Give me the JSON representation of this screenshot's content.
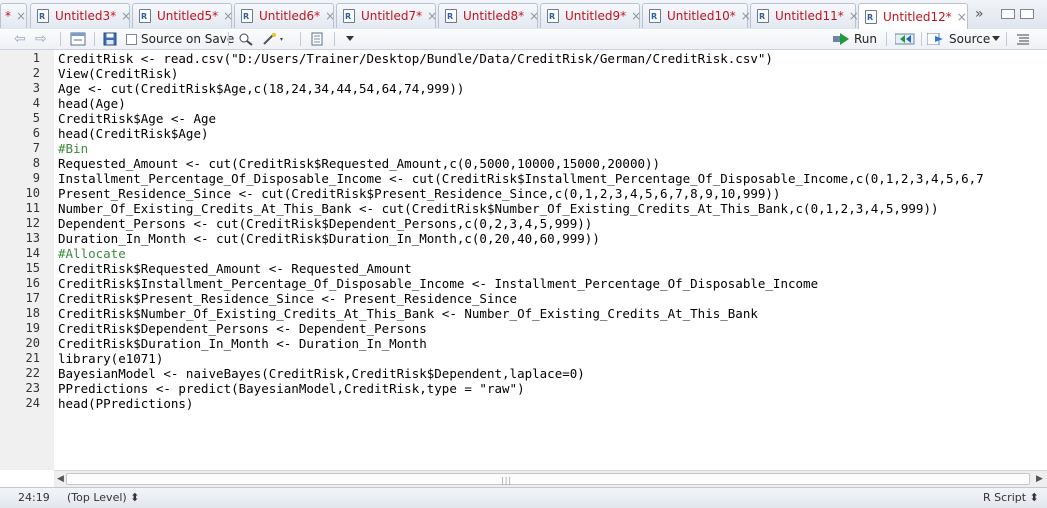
{
  "tabs": [
    {
      "label": "*",
      "active": false
    },
    {
      "label": "Untitled3*",
      "active": false
    },
    {
      "label": "Untitled5*",
      "active": false
    },
    {
      "label": "Untitled6*",
      "active": false
    },
    {
      "label": "Untitled7*",
      "active": false
    },
    {
      "label": "Untitled8*",
      "active": false
    },
    {
      "label": "Untitled9*",
      "active": false
    },
    {
      "label": "Untitled10*",
      "active": false
    },
    {
      "label": "Untitled11*",
      "active": false
    },
    {
      "label": "Untitled12*",
      "active": true
    }
  ],
  "tab_close_glyph": "×",
  "tab_overflow_glyph": "»",
  "toolbar": {
    "source_on_save_label": "Source on Save",
    "run_label": "Run",
    "source_label": "Source"
  },
  "code_lines": [
    {
      "n": "1",
      "text": "CreditRisk <- read.csv(\"D:/Users/Trainer/Desktop/Bundle/Data/CreditRisk/German/CreditRisk.csv\")"
    },
    {
      "n": "2",
      "text": "View(CreditRisk)"
    },
    {
      "n": "3",
      "text": "Age <- cut(CreditRisk$Age,c(18,24,34,44,54,64,74,999))"
    },
    {
      "n": "4",
      "text": "head(Age)"
    },
    {
      "n": "5",
      "text": "CreditRisk$Age <- Age"
    },
    {
      "n": "6",
      "text": "head(CreditRisk$Age)"
    },
    {
      "n": "7",
      "text": "#Bin",
      "comment": true
    },
    {
      "n": "8",
      "text": "Requested_Amount <- cut(CreditRisk$Requested_Amount,c(0,5000,10000,15000,20000))"
    },
    {
      "n": "9",
      "text": "Installment_Percentage_Of_Disposable_Income <- cut(CreditRisk$Installment_Percentage_Of_Disposable_Income,c(0,1,2,3,4,5,6,7"
    },
    {
      "n": "10",
      "text": "Present_Residence_Since <- cut(CreditRisk$Present_Residence_Since,c(0,1,2,3,4,5,6,7,8,9,10,999))"
    },
    {
      "n": "11",
      "text": "Number_Of_Existing_Credits_At_This_Bank <- cut(CreditRisk$Number_Of_Existing_Credits_At_This_Bank,c(0,1,2,3,4,5,999))"
    },
    {
      "n": "12",
      "text": "Dependent_Persons <- cut(CreditRisk$Dependent_Persons,c(0,2,3,4,5,999))"
    },
    {
      "n": "13",
      "text": "Duration_In_Month <- cut(CreditRisk$Duration_In_Month,c(0,20,40,60,999))"
    },
    {
      "n": "14",
      "text": "#Allocate",
      "comment": true
    },
    {
      "n": "15",
      "text": "CreditRisk$Requested_Amount <- Requested_Amount"
    },
    {
      "n": "16",
      "text": "CreditRisk$Installment_Percentage_Of_Disposable_Income <- Installment_Percentage_Of_Disposable_Income"
    },
    {
      "n": "17",
      "text": "CreditRisk$Present_Residence_Since <- Present_Residence_Since"
    },
    {
      "n": "18",
      "text": "CreditRisk$Number_Of_Existing_Credits_At_This_Bank <- Number_Of_Existing_Credits_At_This_Bank"
    },
    {
      "n": "19",
      "text": "CreditRisk$Dependent_Persons <- Dependent_Persons"
    },
    {
      "n": "20",
      "text": "CreditRisk$Duration_In_Month <- Duration_In_Month"
    },
    {
      "n": "21",
      "text": "library(e1071)"
    },
    {
      "n": "22",
      "text": "BayesianModel <- naiveBayes(CreditRisk,CreditRisk$Dependent,laplace=0)"
    },
    {
      "n": "23",
      "text": "PPredictions <- predict(BayesianModel,CreditRisk,type = \"raw\")"
    },
    {
      "n": "24",
      "text": "head(PPredictions)"
    }
  ],
  "status": {
    "cursor_position": "24:19",
    "scope": "(Top Level) ⬍",
    "language": "R Script ⬍"
  },
  "colors": {
    "tab_label": "#c0141c",
    "comment": "#3c8b3c",
    "gutter_bg": "#f0f0f0"
  }
}
